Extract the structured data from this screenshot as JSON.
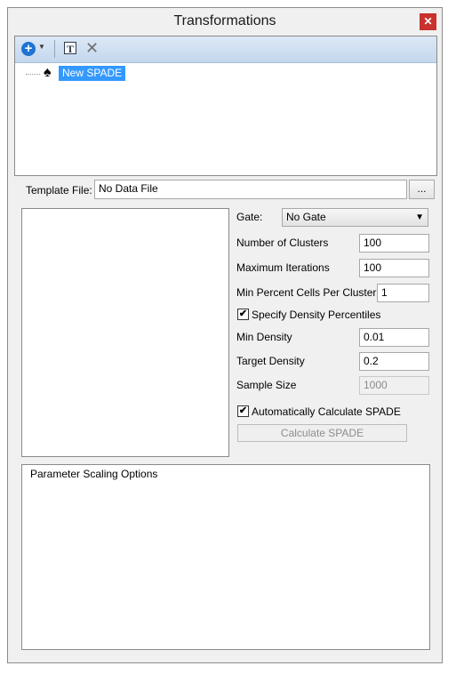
{
  "window": {
    "title": "Transformations",
    "close_glyph": "✕"
  },
  "toolbar": {
    "add_icon": "plus-circle-icon",
    "add_glyph": "+",
    "dropdown_glyph": "▼",
    "template_icon": "template-T-icon",
    "template_glyph": "T",
    "delete_icon": "delete-x-icon",
    "delete_glyph": "✕"
  },
  "tree": {
    "node_icon": "spade-icon",
    "node_glyph": "♠",
    "node_label": "New SPADE"
  },
  "template_file": {
    "label": "Template File:",
    "value": "No Data File",
    "browse_label": "..."
  },
  "settings": {
    "gate": {
      "label": "Gate:",
      "value": "No Gate",
      "chevron": "▼"
    },
    "num_clusters": {
      "label": "Number of Clusters",
      "value": "100"
    },
    "max_iterations": {
      "label": "Maximum Iterations",
      "value": "100"
    },
    "min_percent": {
      "label": "Min Percent Cells Per Cluster",
      "value": "1"
    },
    "specify_density": {
      "label": "Specify Density Percentiles",
      "checked": true,
      "check_glyph": "✔"
    },
    "min_density": {
      "label": "Min Density",
      "value": "0.01"
    },
    "target_density": {
      "label": "Target Density",
      "value": "0.2"
    },
    "sample_size": {
      "label": "Sample Size",
      "value": "1000",
      "disabled": true
    },
    "auto_calc": {
      "label": "Automatically Calculate SPADE",
      "checked": true,
      "check_glyph": "✔"
    },
    "calculate_button": {
      "label": "Calculate SPADE",
      "disabled": true
    }
  },
  "parameter_scaling": {
    "title": "Parameter Scaling Options"
  },
  "colors": {
    "accent": "#3399ff",
    "toolbar_top": "#dce8f6",
    "toolbar_bottom": "#c4d7ee",
    "close": "#c8312c"
  }
}
